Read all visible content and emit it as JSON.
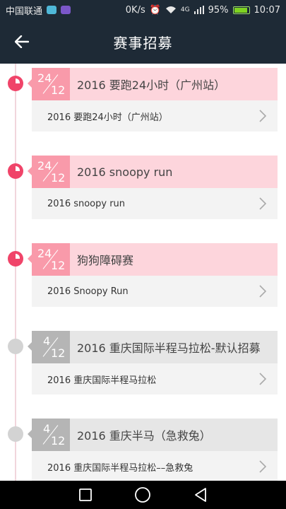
{
  "status_bar": {
    "carrier": "中国联通",
    "speed": "0K/s",
    "signal": "4G",
    "battery": "95%",
    "time": "10:07"
  },
  "header": {
    "title": "赛事招募"
  },
  "events": [
    {
      "day": "24",
      "month": "12",
      "title": "2016 要跑24小时（广州站）",
      "subtitle": "2016 要跑24小时（广州站）",
      "status": "active"
    },
    {
      "day": "24",
      "month": "12",
      "title": "2016 snoopy run",
      "subtitle": "2016 snoopy run",
      "status": "active"
    },
    {
      "day": "24",
      "month": "12",
      "title": "狗狗障碍赛",
      "subtitle": "2016 Snoopy Run",
      "status": "active"
    },
    {
      "day": "4",
      "month": "12",
      "title": "2016 重庆国际半程马拉松-默认招募",
      "subtitle": "2016 重庆国际半程马拉松",
      "status": "inactive"
    },
    {
      "day": "4",
      "month": "12",
      "title": "2016 重庆半马（急救兔）",
      "subtitle": "2016 重庆国际半程马拉松––急救兔",
      "status": "inactive"
    }
  ],
  "colors": {
    "header_bg": "#1e2a36",
    "active_accent": "#f04469",
    "active_badge": "#f99aaa",
    "active_head": "#fdd5dc",
    "inactive_badge": "#b5b5b5",
    "inactive_head": "#e6e6e6"
  },
  "icons": {
    "back": "arrow-left-icon",
    "chevron": "chevron-right-icon",
    "nav_back": "triangle-back-icon",
    "nav_home": "circle-home-icon",
    "nav_recent": "square-recent-icon"
  }
}
